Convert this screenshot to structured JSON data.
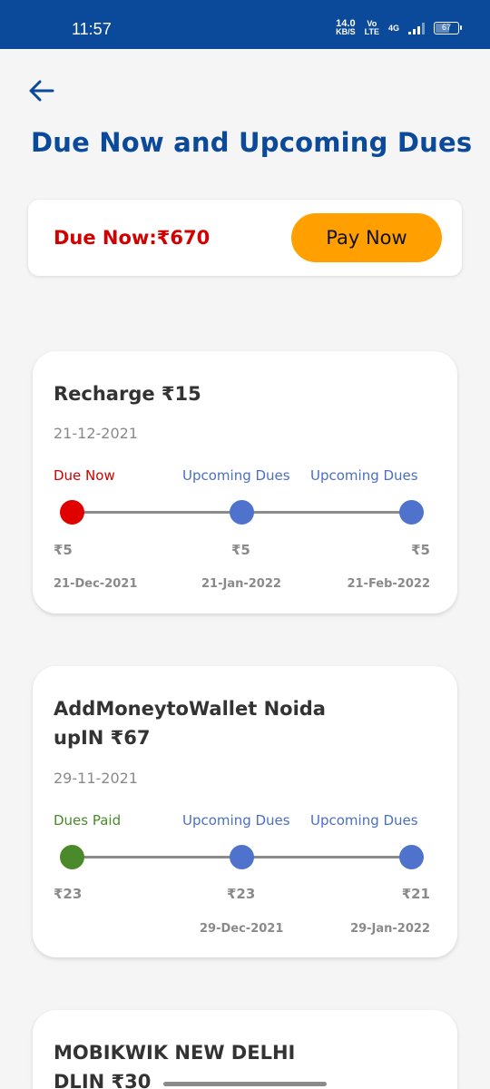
{
  "status_bar": {
    "time": "11:57",
    "net_speed_value": "14.0",
    "net_speed_unit": "KB/S",
    "volte_top": "Vo",
    "volte_bottom": "LTE",
    "network": "4G",
    "battery": "67",
    "battery_level": 0.67
  },
  "header": {
    "back_icon": "arrow-left-icon",
    "title": "Due Now and Upcoming Dues"
  },
  "due_now": {
    "label": "Due Now:₹670",
    "pay_button": "Pay Now"
  },
  "transactions": [
    {
      "title_line1": "Recharge ₹15",
      "title_line2": "",
      "date": "21-12-2021",
      "stages": [
        {
          "status": "Due Now",
          "amount": "₹5",
          "date": "21-Dec-2021",
          "color": "#e00000"
        },
        {
          "status": "Upcoming Dues",
          "amount": "₹5",
          "date": "21-Jan-2022",
          "color": "#4f73cd"
        },
        {
          "status": "Upcoming Dues",
          "amount": "₹5",
          "date": "21-Feb-2022",
          "color": "#4f73cd"
        }
      ]
    },
    {
      "title_line1": "AddMoneytoWallet Noida",
      "title_line2": "upIN ₹67",
      "date": "29-11-2021",
      "stages": [
        {
          "status": "Dues Paid",
          "amount": "₹23",
          "date": "",
          "color": "#4a8a2a"
        },
        {
          "status": "Upcoming Dues",
          "amount": "₹23",
          "date": "29-Dec-2021",
          "color": "#4f73cd"
        },
        {
          "status": "Upcoming Dues",
          "amount": "₹21",
          "date": "29-Jan-2022",
          "color": "#4f73cd"
        }
      ]
    },
    {
      "title_line1": "MOBIKWIK NEW DELHI",
      "title_line2": "DLIN ₹30"
    }
  ]
}
